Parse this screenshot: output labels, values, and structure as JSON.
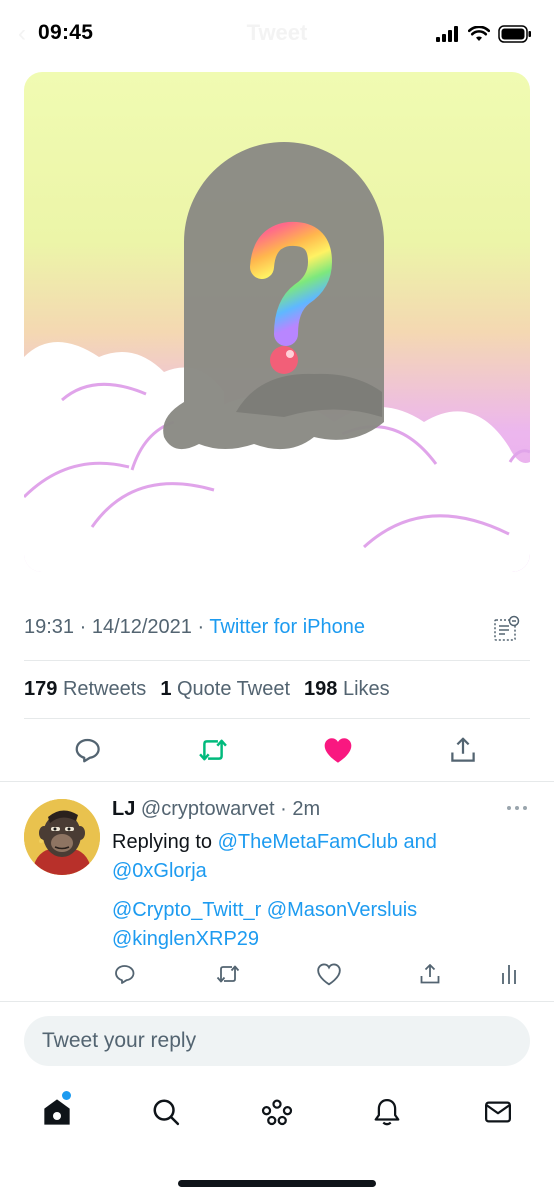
{
  "status_bar": {
    "time": "09:45"
  },
  "header": {
    "title": "Tweet"
  },
  "tweet": {
    "timestamp": "19:31 · 14/12/2021 · ",
    "source": "Twitter for iPhone",
    "stats": {
      "retweets_count": "179",
      "retweets_label": "Retweets",
      "quotes_count": "1",
      "quotes_label": "Quote Tweet",
      "likes_count": "198",
      "likes_label": "Likes"
    },
    "liked": true
  },
  "reply": {
    "name": "LJ",
    "handle_time": "@cryptowarvet · 2m",
    "replying_prefix": "Replying to ",
    "replying_user1": "@TheMetaFamClub",
    "replying_and": " and",
    "replying_user2": "@0xGlorja",
    "mentions": [
      "@Crypto_Twitt_r",
      "@MasonVersluis",
      "@kinglenXRP29"
    ]
  },
  "composer": {
    "placeholder": "Tweet your reply"
  },
  "colors": {
    "accent": "#1d9bf0",
    "like": "#f91880",
    "retweet": "#00ba7c",
    "muted": "#536471"
  },
  "icons": {
    "tweet_actions": [
      "reply-icon",
      "retweet-icon",
      "like-icon",
      "share-icon"
    ],
    "reply_actions": [
      "reply-icon",
      "retweet-icon",
      "like-icon",
      "share-icon",
      "analytics-icon"
    ],
    "tabs": [
      "home-icon",
      "search-icon",
      "spaces-icon",
      "notifications-icon",
      "messages-icon"
    ]
  }
}
